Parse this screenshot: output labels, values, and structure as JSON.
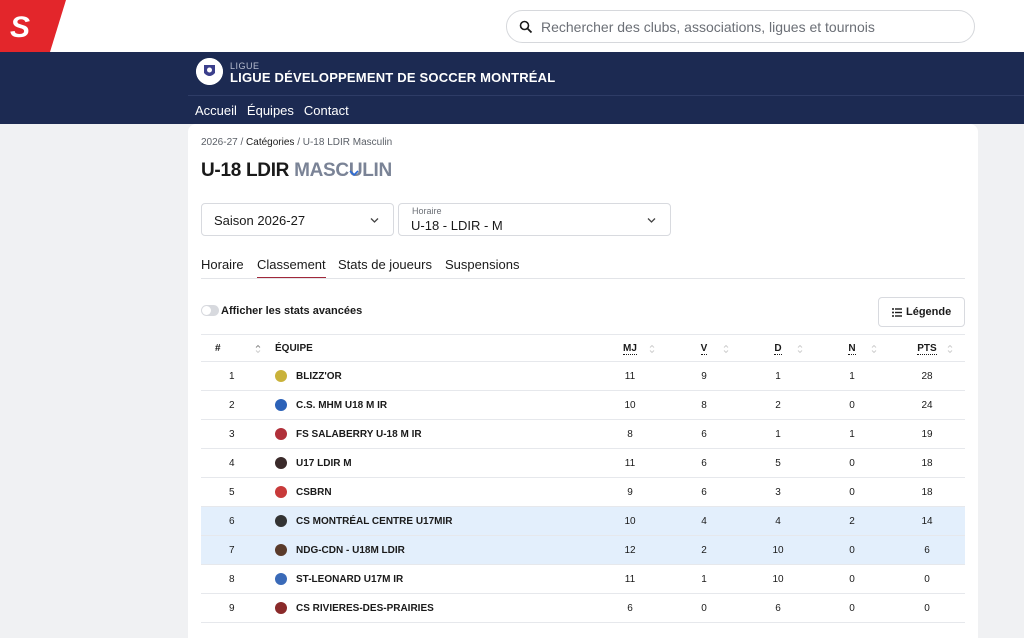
{
  "colors": {
    "accent": "#a0283a",
    "navy": "#1c2a52",
    "highlight": "#e3effc",
    "brand_red": "#e3262b"
  },
  "search": {
    "placeholder": "Rechercher des clubs, associations, ligues et tournois"
  },
  "league": {
    "kicker": "LIGUE",
    "name": "LIGUE DÉVELOPPEMENT DE SOCCER MONTRÉAL"
  },
  "nav": {
    "items": [
      "Accueil",
      "Équipes",
      "Contact"
    ]
  },
  "breadcrumb": {
    "season": "2026-27",
    "categories": "Catégories",
    "current": "U-18 LDIR Masculin"
  },
  "title": {
    "main": "U-18 LDIR",
    "sub": "MASCULIN"
  },
  "filters": {
    "season_value": "Saison 2026-27",
    "schedule_label": "Horaire",
    "schedule_value": "U-18 - LDIR - M"
  },
  "tabs": [
    "Horaire",
    "Classement",
    "Stats de joueurs",
    "Suspensions"
  ],
  "advanced": {
    "label": "Afficher les stats avancées"
  },
  "legend": {
    "label": "Légende"
  },
  "table": {
    "headers": {
      "rank": "#",
      "team": "ÉQUIPE",
      "gp": "MJ",
      "w": "V",
      "l": "D",
      "t": "N",
      "pts": "PTS"
    },
    "rows": [
      {
        "rank": "1",
        "team": "BLIZZ'OR",
        "gp": "11",
        "w": "9",
        "l": "1",
        "t": "1",
        "pts": "28",
        "badge": "#c9b23a",
        "highlight": false
      },
      {
        "rank": "2",
        "team": "C.S. MHM U18 M IR",
        "gp": "10",
        "w": "8",
        "l": "2",
        "t": "0",
        "pts": "24",
        "badge": "#2c62b8",
        "highlight": false
      },
      {
        "rank": "3",
        "team": "FS SALABERRY U-18 M IR",
        "gp": "8",
        "w": "6",
        "l": "1",
        "t": "1",
        "pts": "19",
        "badge": "#b0303a",
        "highlight": false
      },
      {
        "rank": "4",
        "team": "U17 LDIR M",
        "gp": "11",
        "w": "6",
        "l": "5",
        "t": "0",
        "pts": "18",
        "badge": "#3a2a2a",
        "highlight": false
      },
      {
        "rank": "5",
        "team": "CSBRN",
        "gp": "9",
        "w": "6",
        "l": "3",
        "t": "0",
        "pts": "18",
        "badge": "#c83a3a",
        "highlight": false
      },
      {
        "rank": "6",
        "team": "CS MONTRÉAL CENTRE U17MIR",
        "gp": "10",
        "w": "4",
        "l": "4",
        "t": "2",
        "pts": "14",
        "badge": "#333333",
        "highlight": true
      },
      {
        "rank": "7",
        "team": "NDG-CDN - U18M LDIR",
        "gp": "12",
        "w": "2",
        "l": "10",
        "t": "0",
        "pts": "6",
        "badge": "#5a3a2a",
        "highlight": true
      },
      {
        "rank": "8",
        "team": "ST-LEONARD U17M IR",
        "gp": "11",
        "w": "1",
        "l": "10",
        "t": "0",
        "pts": "0",
        "badge": "#3a6ab8",
        "highlight": false
      },
      {
        "rank": "9",
        "team": "CS RIVIERES-DES-PRAIRIES",
        "gp": "6",
        "w": "0",
        "l": "6",
        "t": "0",
        "pts": "0",
        "badge": "#8a2a2a",
        "highlight": false
      }
    ]
  }
}
